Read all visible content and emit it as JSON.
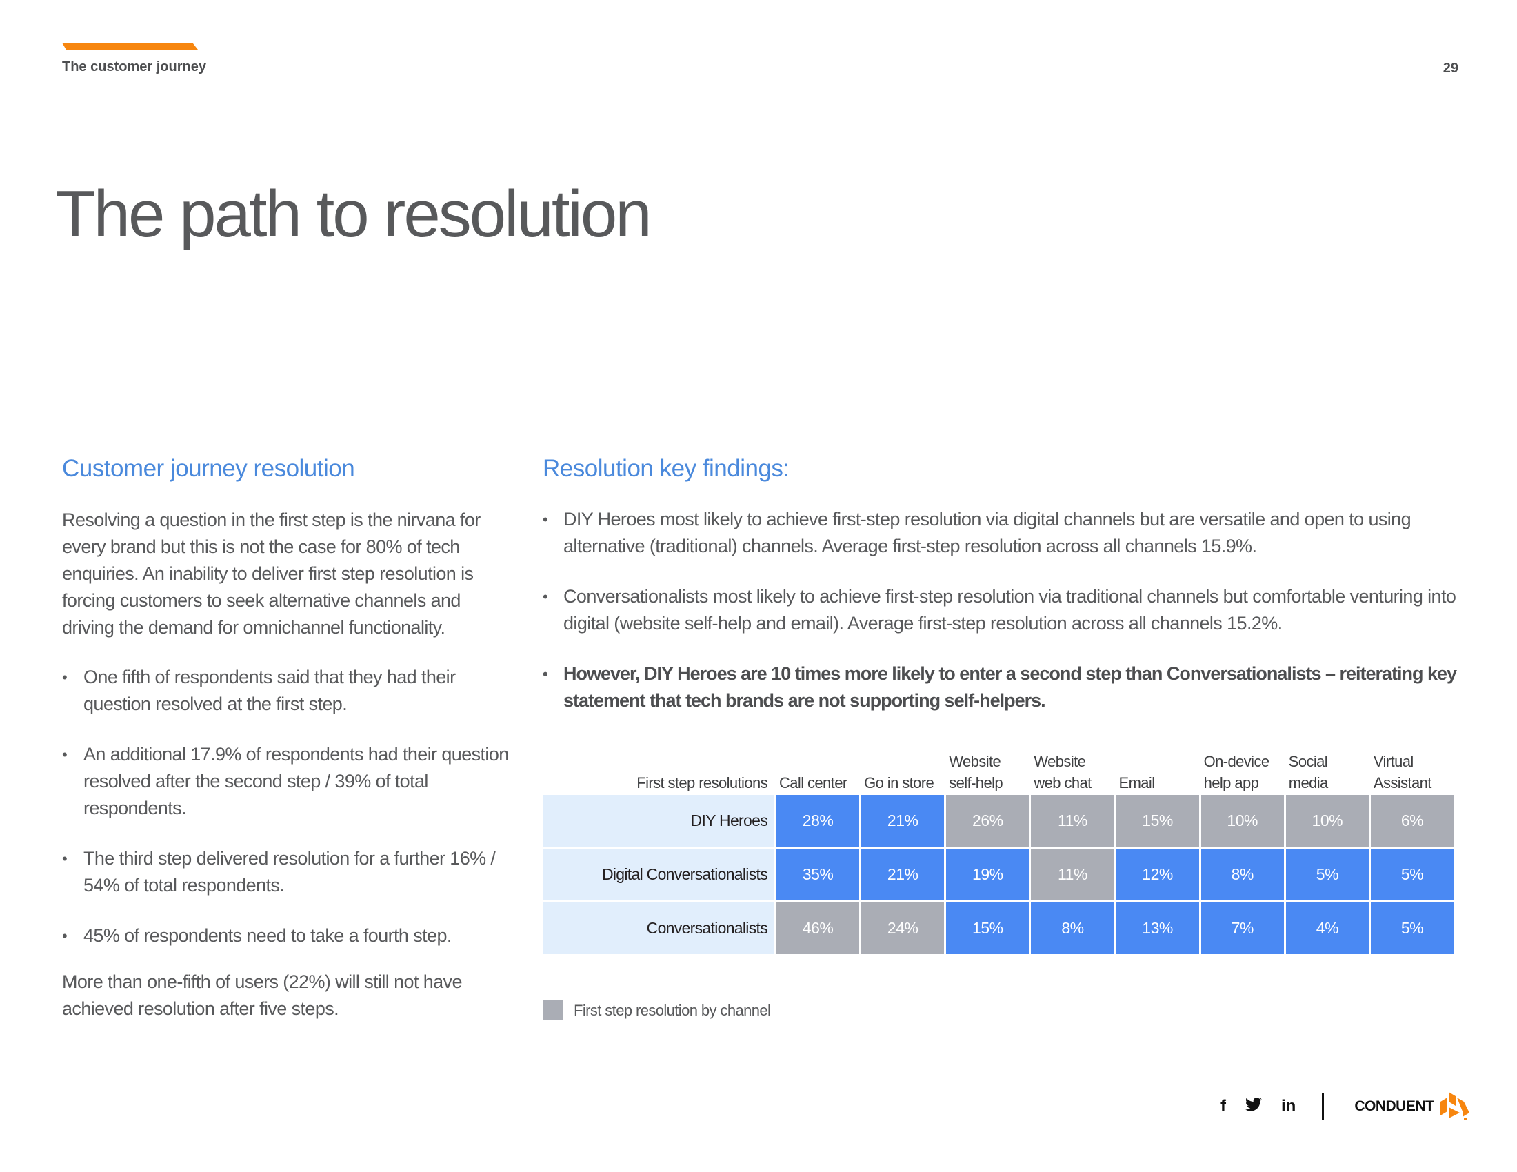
{
  "header": {
    "section_label": "The customer journey",
    "page_number": "29",
    "accent_color": "#f7860f"
  },
  "title": "The path to resolution",
  "left_column": {
    "heading": "Customer journey resolution",
    "intro": "Resolving a question in the first step is the nirvana for every brand but this is not the case for 80% of tech enquiries. An inability to deliver first step resolution is forcing customers to seek alternative channels and driving the demand for omnichannel functionality.",
    "bullets": [
      "One fifth of respondents said that they had their question resolved at the first step.",
      "An additional 17.9% of respondents had their question resolved after the second step / 39% of total respondents.",
      "The third step delivered resolution for a further 16% / 54% of total respondents.",
      "45% of respondents need to take a fourth step."
    ],
    "closing": "More than one-fifth of users (22%) will still not have achieved resolution after five steps."
  },
  "right_column": {
    "heading": "Resolution key findings:",
    "bullets": [
      {
        "text": "DIY Heroes most likely to achieve first-step resolution via digital channels but are versatile and open to using alternative (traditional) channels. Average first-step resolution across all channels 15.9%.",
        "bold": false
      },
      {
        "text": "Conversationalists most likely to achieve first-step resolution via traditional channels but comfortable venturing into digital (website self-help and email). Average first-step resolution across all channels 15.2%.",
        "bold": false
      },
      {
        "text": "However, DIY Heroes are 10 times more likely to enter a second step than Conversationalists – reiterating key statement that tech brands are not supporting self-helpers.",
        "bold": true
      }
    ]
  },
  "chart_data": {
    "type": "table",
    "title": "First step resolutions",
    "columns": [
      "Call center",
      "Go in store",
      "Website self-help",
      "Website web chat",
      "Email",
      "On-device help app",
      "Social media",
      "Virtual Assistant"
    ],
    "column_lines": [
      [
        "",
        "Call center"
      ],
      [
        "",
        "Go in store"
      ],
      [
        "Website",
        "self-help"
      ],
      [
        "Website",
        "web chat"
      ],
      [
        "",
        "Email"
      ],
      [
        "On-device",
        "help app"
      ],
      [
        "Social",
        "media"
      ],
      [
        "Virtual",
        "Assistant"
      ]
    ],
    "rows": [
      {
        "label": "DIY Heroes",
        "values": [
          28,
          21,
          26,
          11,
          15,
          10,
          10,
          6
        ],
        "highlight": [
          "blue",
          "blue",
          "grey",
          "grey",
          "grey",
          "grey",
          "grey",
          "grey"
        ]
      },
      {
        "label": "Digital Conversationalists",
        "values": [
          35,
          21,
          19,
          11,
          12,
          8,
          5,
          5
        ],
        "highlight": [
          "blue",
          "blue",
          "blue",
          "grey",
          "blue",
          "blue",
          "blue",
          "blue"
        ]
      },
      {
        "label": "Conversationalists",
        "values": [
          46,
          24,
          15,
          8,
          13,
          7,
          4,
          5
        ],
        "highlight": [
          "grey",
          "grey",
          "blue",
          "blue",
          "blue",
          "blue",
          "blue",
          "blue"
        ]
      }
    ],
    "unit": "%",
    "legend": [
      {
        "label": "First step resolution by channel",
        "color": "#aaadb5"
      }
    ],
    "colors": {
      "blue": "#4a89f3",
      "grey": "#aaadb5",
      "label_bg": "#e1eefc"
    }
  },
  "footer": {
    "social": [
      {
        "name": "facebook",
        "glyph": "f"
      },
      {
        "name": "twitter",
        "glyph": "🐦"
      },
      {
        "name": "linkedin",
        "glyph": "in"
      }
    ],
    "brand": "CONDUENT"
  }
}
